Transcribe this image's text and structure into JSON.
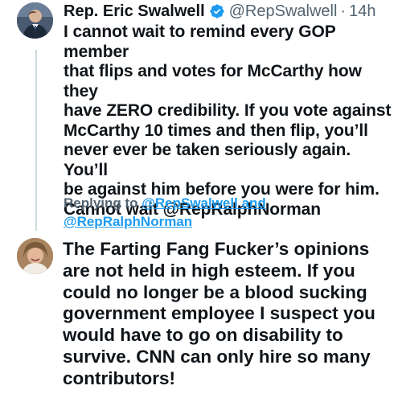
{
  "tweet": {
    "author_name": "Rep. Eric Swalwell",
    "handle": "@RepSwalwell",
    "separator": "·",
    "time": "14h",
    "text": "I cannot wait to remind every GOP member\nthat flips and votes for McCarthy how they\nhave ZERO credibility. If you vote against\nMcCarthy 10 times and then flip, you’ll\nnever ever be taken seriously again. You’ll\nbe against him before you were for him.\nCannot wait @RepRalphNorman",
    "verified_icon": "verified-badge-icon",
    "verified_color": "#1d9bf0"
  },
  "reply": {
    "replying_label": "Replying to ",
    "mention_1": "@RepSwalwell",
    "connector": "and",
    "mention_2": "@RepRalphNorman",
    "text": "The Farting Fang Fucker’s opinions\nare not held in high esteem. If you\ncould no longer be a blood sucking\ngovernment employee I suspect you\nwould have to go on disability to\nsurvive.  CNN can only hire so many\ncontributors!"
  }
}
